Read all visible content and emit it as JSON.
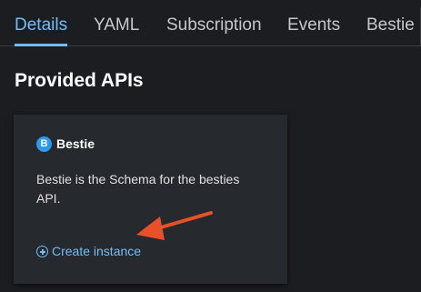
{
  "tabs": [
    {
      "label": "Details",
      "active": true
    },
    {
      "label": "YAML",
      "active": false
    },
    {
      "label": "Subscription",
      "active": false
    },
    {
      "label": "Events",
      "active": false
    },
    {
      "label": "Bestie",
      "active": false
    }
  ],
  "section": {
    "title": "Provided APIs"
  },
  "card": {
    "badge": "B",
    "name": "Bestie",
    "description": "Bestie is the Schema for the besties API.",
    "create_link": "Create instance"
  },
  "colors": {
    "accent": "#73bcf7",
    "badge": "#2b9af3",
    "annotation_arrow": "#e8502a",
    "background": "#1b1d21",
    "card": "#26292d"
  },
  "icons": {
    "create": "plus-circle-icon",
    "annotation": "arrow-annotation-icon"
  }
}
